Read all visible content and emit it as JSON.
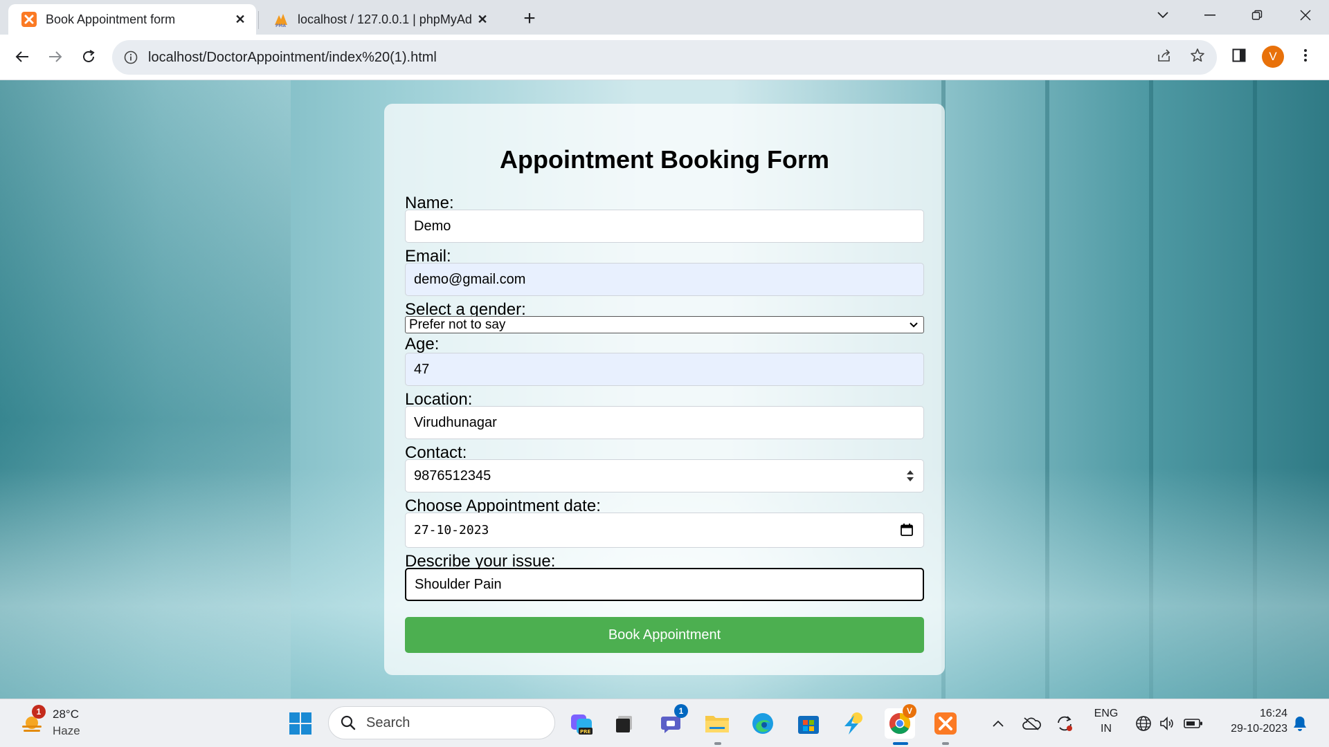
{
  "browser": {
    "tabs": [
      {
        "title": "Book Appointment form",
        "active": true
      },
      {
        "title": "localhost / 127.0.0.1 | phpMyAdr",
        "active": false
      }
    ],
    "url": "localhost/DoctorAppointment/index%20(1).html",
    "profile_initial": "V"
  },
  "form": {
    "heading": "Appointment Booking Form",
    "name_label": "Name:",
    "name_value": "Demo",
    "email_label": "Email:",
    "email_value": "demo@gmail.com",
    "gender_label": "Select a gender:",
    "gender_value": "Prefer not to say",
    "age_label": "Age:",
    "age_value": "47",
    "location_label": "Location:",
    "location_value": "Virudhunagar",
    "contact_label": "Contact:",
    "contact_value": "9876512345",
    "date_label": "Choose Appointment date:",
    "date_value": "27-10-2023",
    "issue_label": "Describe your issue:",
    "issue_value": "Shoulder Pain",
    "submit_label": "Book Appointment"
  },
  "taskbar": {
    "weather_temp": "28°C",
    "weather_condition": "Haze",
    "weather_badge": "1",
    "search_placeholder": "Search",
    "teams_badge": "1",
    "language_line1": "ENG",
    "language_line2": "IN",
    "time": "16:24",
    "date": "29-10-2023"
  },
  "colors": {
    "submit_button": "#4caf50",
    "profile_avatar": "#e8710a",
    "notification_badge": "#c42b1c"
  }
}
